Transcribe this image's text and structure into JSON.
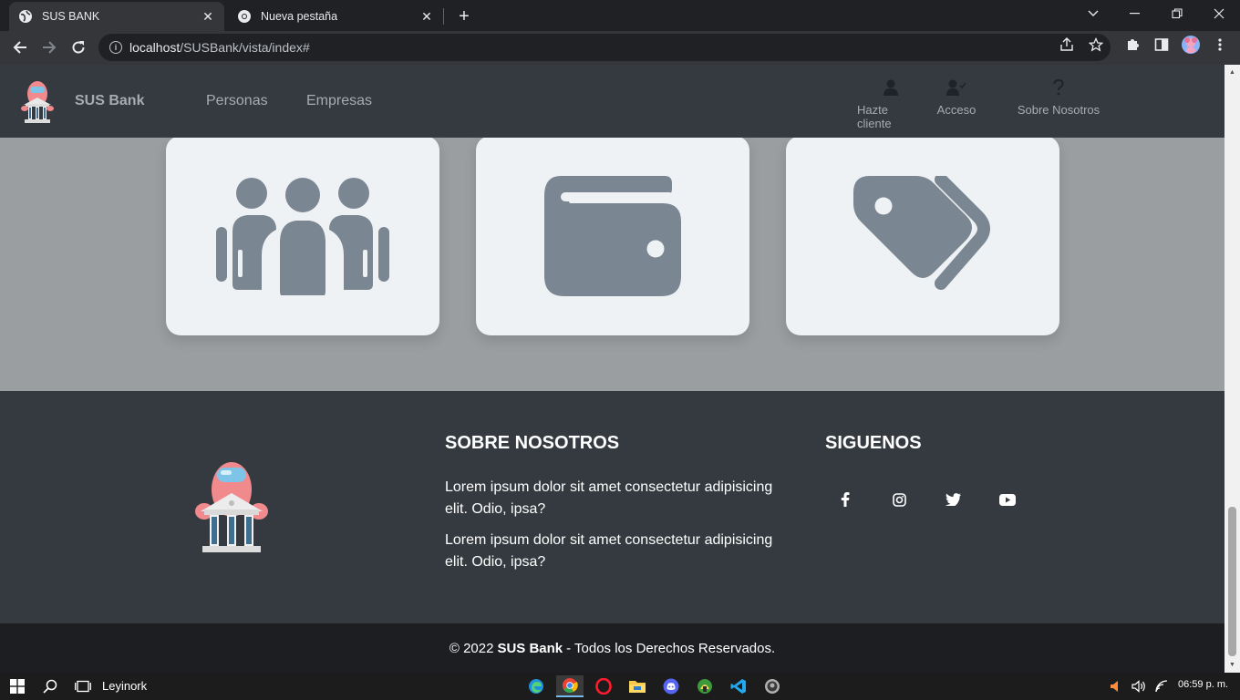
{
  "browser": {
    "tabs": [
      {
        "title": "SUS BANK",
        "active": true
      },
      {
        "title": "Nueva pestaña",
        "active": false
      }
    ],
    "new_tab_label": "+",
    "url_host": "localhost",
    "url_path": "/SUSBank/vista/index#"
  },
  "site": {
    "brand": "SUS Bank",
    "nav_links": [
      "Personas",
      "Empresas"
    ],
    "nav_right": [
      {
        "label": "Hazte cliente",
        "icon": "user-icon"
      },
      {
        "label": "Acceso",
        "icon": "user-check-icon"
      },
      {
        "label": "Sobre Nosotros",
        "icon": "question-icon"
      }
    ],
    "cards": [
      {
        "icon": "people-group-icon"
      },
      {
        "icon": "wallet-icon"
      },
      {
        "icon": "tags-icon"
      }
    ],
    "footer": {
      "about_heading": "SOBRE NOSOTROS",
      "about_paragraphs": [
        "Lorem ipsum dolor sit amet consectetur adipisicing elit. Odio, ipsa?",
        "Lorem ipsum dolor sit amet consectetur adipisicing elit. Odio, ipsa?"
      ],
      "social_heading": "SIGUENOS",
      "social_icons": [
        "facebook-icon",
        "instagram-icon",
        "twitter-icon",
        "youtube-icon"
      ]
    },
    "copyright": {
      "prefix": "© 2022",
      "brand": "SUS Bank",
      "suffix": "- Todos los Derechos Reservados."
    },
    "colors": {
      "nav_bg": "#343a40",
      "card_bg": "#eff2f5",
      "card_icon": "#7a8692",
      "page_bg": "#9a9ea0",
      "copyright_bg": "#1c1e21"
    }
  },
  "taskbar": {
    "user": "Leyinork",
    "time": "06:59 p. m."
  }
}
